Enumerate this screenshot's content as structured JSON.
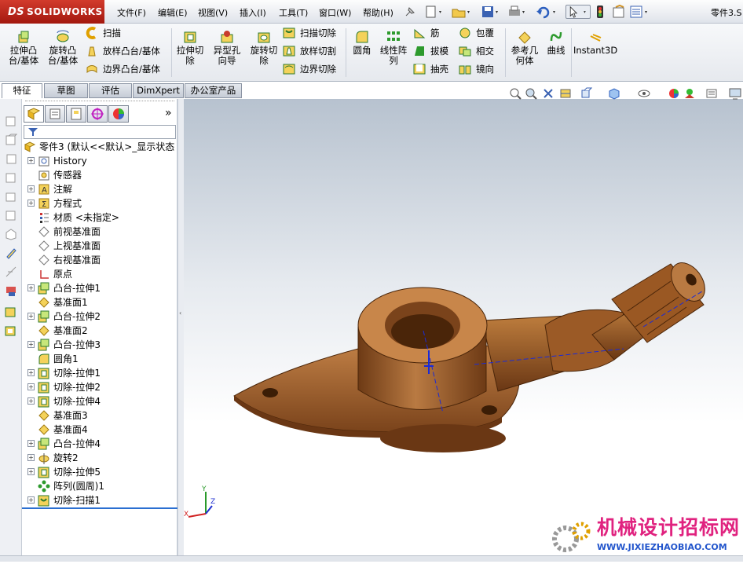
{
  "app": {
    "brand": "SOLIDWORKS",
    "brand_prefix": "DS",
    "window_title": "零件3.S"
  },
  "menu": [
    "文件(F)",
    "编辑(E)",
    "视图(V)",
    "插入(I)",
    "工具(T)",
    "窗口(W)",
    "帮助(H)"
  ],
  "cmd": {
    "extrude_boss": "拉伸凸台/基体",
    "revolve_boss": "旋转凸台/基体",
    "sweep": "扫描",
    "loft_boss": "放样凸台/基体",
    "boundary_boss": "边界凸台/基体",
    "extrude_cut": "拉伸切除",
    "hole_wizard": "异型孔向导",
    "revolve_cut": "旋转切除",
    "swept_cut": "扫描切除",
    "loft_cut": "放样切割",
    "boundary_cut": "边界切除",
    "fillet": "圆角",
    "linear_pattern": "线性阵列",
    "rib": "筋",
    "draft": "拔模",
    "shell": "抽壳",
    "wrap": "包覆",
    "intersect": "相交",
    "mirror": "镜向",
    "ref_geometry": "参考几何体",
    "curves": "曲线",
    "instant3d": "Instant3D"
  },
  "tabs": [
    "特征",
    "草图",
    "评估",
    "DimXpert",
    "办公室产品"
  ],
  "active_tab": "特征",
  "tree": {
    "root": "零件3  (默认<<默认>_显示状态",
    "items": [
      {
        "label": "History",
        "icon": "history-icon",
        "expand": true
      },
      {
        "label": "传感器",
        "icon": "sensor-icon",
        "expand": false
      },
      {
        "label": "注解",
        "icon": "annotation-icon",
        "expand": true
      },
      {
        "label": "方程式",
        "icon": "equation-icon",
        "expand": true
      },
      {
        "label": "材质 <未指定>",
        "icon": "material-icon",
        "expand": false
      },
      {
        "label": "前视基准面",
        "icon": "plane-icon",
        "expand": false
      },
      {
        "label": "上视基准面",
        "icon": "plane-icon",
        "expand": false
      },
      {
        "label": "右视基准面",
        "icon": "plane-icon",
        "expand": false
      },
      {
        "label": "原点",
        "icon": "origin-icon",
        "expand": false
      },
      {
        "label": "凸台-拉伸1",
        "icon": "boss-extrude-icon",
        "expand": true
      },
      {
        "label": "基准面1",
        "icon": "plane-yellow-icon",
        "expand": false
      },
      {
        "label": "凸台-拉伸2",
        "icon": "boss-extrude-icon",
        "expand": true
      },
      {
        "label": "基准面2",
        "icon": "plane-yellow-icon",
        "expand": false
      },
      {
        "label": "凸台-拉伸3",
        "icon": "boss-extrude-icon",
        "expand": true
      },
      {
        "label": "圆角1",
        "icon": "fillet-icon",
        "expand": false
      },
      {
        "label": "切除-拉伸1",
        "icon": "cut-extrude-icon",
        "expand": true
      },
      {
        "label": "切除-拉伸2",
        "icon": "cut-extrude-icon",
        "expand": true
      },
      {
        "label": "切除-拉伸4",
        "icon": "cut-extrude-icon",
        "expand": true
      },
      {
        "label": "基准面3",
        "icon": "plane-yellow-icon",
        "expand": false
      },
      {
        "label": "基准面4",
        "icon": "plane-yellow-icon",
        "expand": false
      },
      {
        "label": "凸台-拉伸4",
        "icon": "boss-extrude-icon",
        "expand": true
      },
      {
        "label": "旋转2",
        "icon": "revolve-icon",
        "expand": true
      },
      {
        "label": "切除-拉伸5",
        "icon": "cut-extrude-icon",
        "expand": true
      },
      {
        "label": "阵列(圆周)1",
        "icon": "circular-pattern-icon",
        "expand": false
      },
      {
        "label": "切除-扫描1",
        "icon": "cut-sweep-icon",
        "expand": true
      }
    ]
  },
  "triad": {
    "x": "X",
    "y": "Y",
    "z": "Z"
  },
  "watermark": {
    "cn": "机械设计招标网",
    "url": "WWW.JIXIEZHAOBIAO.COM"
  },
  "colors": {
    "part": "#8a4f22",
    "brand_red": "#c0271c",
    "watermark_pink": "#e0227f"
  }
}
